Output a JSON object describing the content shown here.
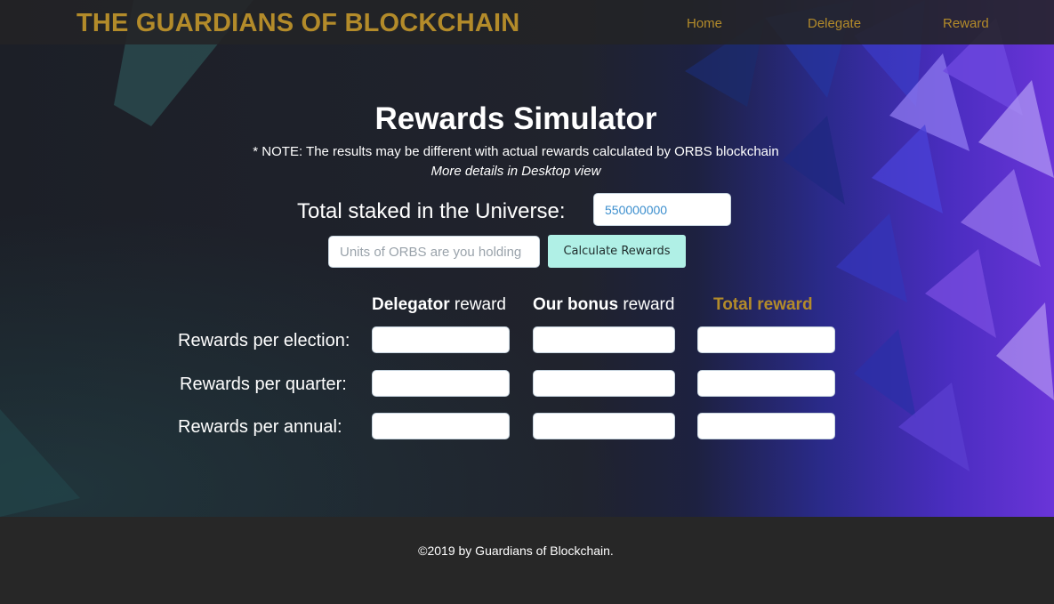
{
  "header": {
    "site_title": "THE GUARDIANS OF BLOCKCHAIN",
    "nav": [
      "Home",
      "Delegate",
      "Reward"
    ]
  },
  "main": {
    "title": "Rewards Simulator",
    "note": "* NOTE: The results may be different with actual rewards calculated by ORBS blockchain",
    "note_sub": "More details in Desktop view",
    "universe_label": "Total staked in the Universe:",
    "universe_value": "550000000",
    "holding_placeholder": "Units of ORBS are you holding",
    "calculate_label": "Calculate Rewards",
    "columns": {
      "delegator_bold": "Delegator",
      "delegator_rest": " reward",
      "bonus_bold": "Our bonus",
      "bonus_rest": " reward",
      "total": "Total reward"
    },
    "rows": [
      "Rewards per election:",
      "Rewards per quarter:",
      "Rewards per annual:"
    ]
  },
  "footer": {
    "copyright": "©2019 by Guardians of Blockchain."
  },
  "colors": {
    "accent_gold": "#b38b2a",
    "button_mint": "#b0f0e6",
    "nav_bg": "#232326",
    "footer_bg": "#272727"
  }
}
